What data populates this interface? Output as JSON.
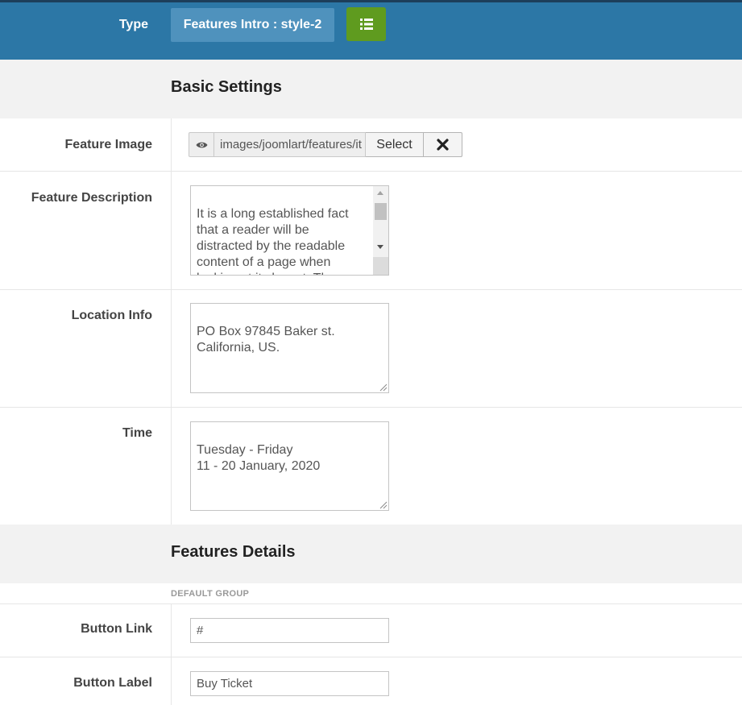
{
  "header": {
    "type_label": "Type",
    "type_value": "Features Intro : style-2",
    "list_button_icon": "list-icon",
    "bar_color": "#2c77a6",
    "button_color": "#5f9b1f"
  },
  "basic_settings": {
    "title": "Basic Settings",
    "feature_image": {
      "label": "Feature Image",
      "preview_icon": "eye-icon",
      "value": "images/joomlart/features/it",
      "select_label": "Select",
      "clear_icon": "close-icon"
    },
    "feature_description": {
      "label": "Feature Description",
      "value": "It is a long established fact that a reader will be distracted by the readable content of a page when looking at its layout. The point of using"
    },
    "location_info": {
      "label": "Location Info",
      "value": "PO Box 97845 Baker st.\nCalifornia, US."
    },
    "time": {
      "label": "Time",
      "value": "Tuesday - Friday\n11 - 20 January, 2020"
    }
  },
  "features_details": {
    "title": "Features Details",
    "group_label": "DEFAULT GROUP",
    "button_link": {
      "label": "Button Link",
      "value": "#"
    },
    "button_label": {
      "label": "Button Label",
      "value": "Buy Ticket"
    }
  }
}
